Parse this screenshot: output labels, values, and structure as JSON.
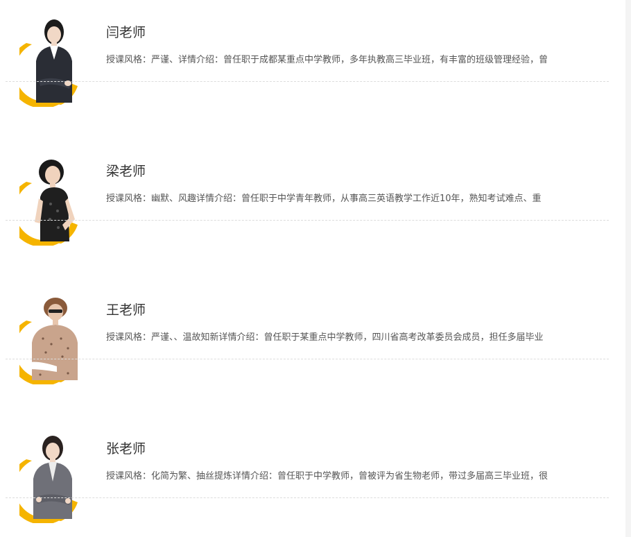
{
  "colors": {
    "accent": "#f5b400",
    "divider": "#dcdcdc",
    "name_text": "#333333",
    "desc_text": "#555555"
  },
  "teachers": [
    {
      "name": "闫老师",
      "description": "授课风格：严谨、详情介绍：曾任职于成都某重点中学教师，多年执教高三毕业班，有丰富的班级管理经验，曾",
      "avatar_icon": "teacher-portrait-icon"
    },
    {
      "name": "梁老师",
      "description": "授课风格：幽默、风趣详情介绍：曾任职于中学青年教师，从事高三英语教学工作近10年，熟知考试难点、重",
      "avatar_icon": "teacher-portrait-icon"
    },
    {
      "name": "王老师",
      "description": "授课风格：严谨、、温故知新详情介绍：曾任职于某重点中学教师，四川省高考改革委员会成员，担任多届毕业",
      "avatar_icon": "teacher-portrait-icon"
    },
    {
      "name": "张老师",
      "description": "授课风格：化简为繁、抽丝提炼详情介绍：曾任职于中学教师，曾被评为省生物老师，带过多届高三毕业班，很",
      "avatar_icon": "teacher-portrait-icon"
    }
  ]
}
